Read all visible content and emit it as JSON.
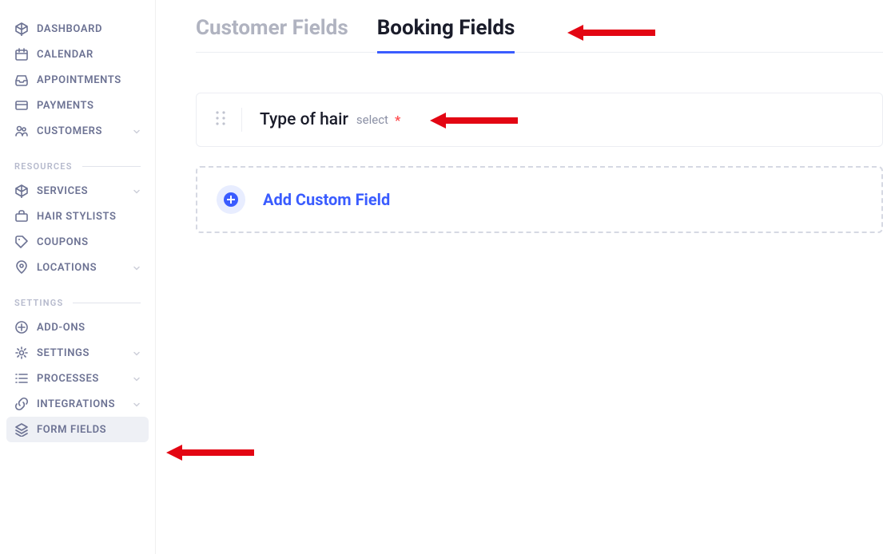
{
  "sidebar": {
    "main": [
      {
        "label": "DASHBOARD",
        "icon": "cube",
        "chevron": false
      },
      {
        "label": "CALENDAR",
        "icon": "calendar",
        "chevron": false
      },
      {
        "label": "APPOINTMENTS",
        "icon": "inbox",
        "chevron": false
      },
      {
        "label": "PAYMENTS",
        "icon": "card",
        "chevron": false
      },
      {
        "label": "CUSTOMERS",
        "icon": "users",
        "chevron": true
      }
    ],
    "resources_header": "RESOURCES",
    "resources": [
      {
        "label": "SERVICES",
        "icon": "cube",
        "chevron": true
      },
      {
        "label": "HAIR STYLISTS",
        "icon": "case",
        "chevron": false
      },
      {
        "label": "COUPONS",
        "icon": "tag",
        "chevron": false
      },
      {
        "label": "LOCATIONS",
        "icon": "pin",
        "chevron": true
      }
    ],
    "settings_header": "SETTINGS",
    "settings": [
      {
        "label": "ADD-ONS",
        "icon": "plus-circle",
        "chevron": false,
        "active": false
      },
      {
        "label": "SETTINGS",
        "icon": "gear",
        "chevron": true,
        "active": false
      },
      {
        "label": "PROCESSES",
        "icon": "list",
        "chevron": true,
        "active": false
      },
      {
        "label": "INTEGRATIONS",
        "icon": "link",
        "chevron": true,
        "active": false
      },
      {
        "label": "FORM FIELDS",
        "icon": "layers",
        "chevron": false,
        "active": true
      }
    ]
  },
  "tabs": [
    {
      "label": "Customer Fields",
      "active": false
    },
    {
      "label": "Booking Fields",
      "active": true
    }
  ],
  "fields": [
    {
      "label": "Type of hair",
      "type": "select",
      "required": true
    }
  ],
  "add_custom_field_label": "Add Custom Field",
  "required_marker": "*",
  "colors": {
    "accent": "#3a5cff",
    "muted": "#6c7293",
    "danger": "#ff4d4f",
    "arrow": "#e30613"
  }
}
